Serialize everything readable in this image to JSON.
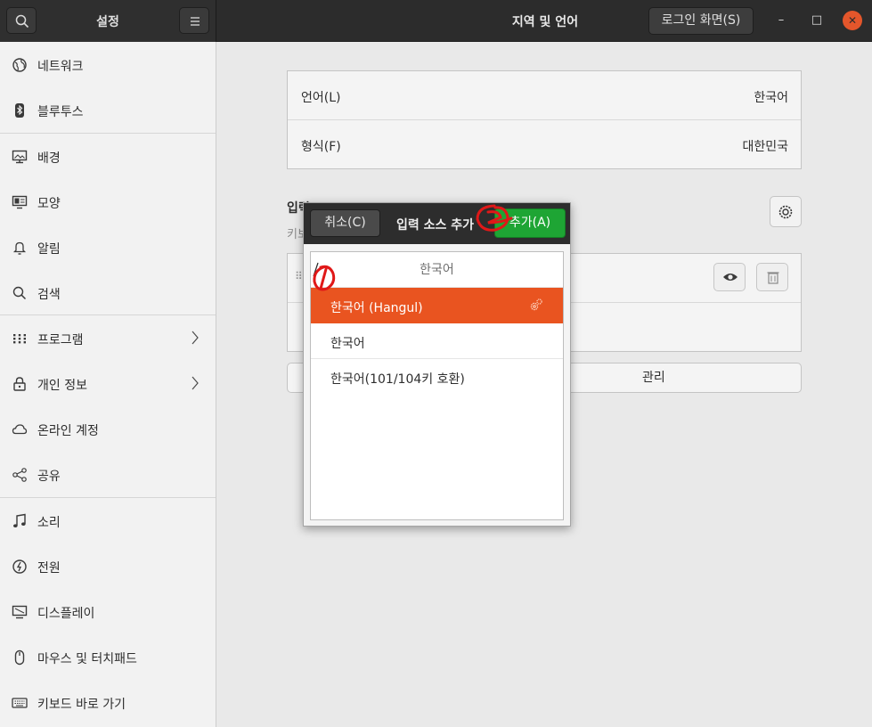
{
  "window": {
    "left_title": "설정",
    "title": "지역 및 언어",
    "login_button": "로그인 화면(S)",
    "min_symbol": "–",
    "max_symbol": "□",
    "close_symbol": "✕"
  },
  "sidebar": {
    "items": [
      {
        "label": "네트워크",
        "icon": "network-icon"
      },
      {
        "label": "블루투스",
        "icon": "bluetooth-icon"
      },
      {
        "label": "배경",
        "icon": "background-icon"
      },
      {
        "label": "모양",
        "icon": "appearance-icon"
      },
      {
        "label": "알림",
        "icon": "bell-icon"
      },
      {
        "label": "검색",
        "icon": "search-icon"
      },
      {
        "label": "프로그램",
        "icon": "apps-grid-icon"
      },
      {
        "label": "개인 정보",
        "icon": "lock-icon"
      },
      {
        "label": "온라인 계정",
        "icon": "cloud-icon"
      },
      {
        "label": "공유",
        "icon": "share-icon"
      },
      {
        "label": "소리",
        "icon": "music-note-icon"
      },
      {
        "label": "전원",
        "icon": "power-icon"
      },
      {
        "label": "디스플레이",
        "icon": "display-icon"
      },
      {
        "label": "마우스 및 터치패드",
        "icon": "mouse-icon"
      },
      {
        "label": "키보드 바로 가기",
        "icon": "keyboard-icon"
      }
    ]
  },
  "main": {
    "language_label": "언어(L)",
    "language_value": "한국어",
    "formats_label": "형식(F)",
    "formats_value": "대한민국",
    "input_section_title": "입력",
    "input_section_sub": "키보",
    "manage_button": "관리"
  },
  "dialog": {
    "cancel": "취소(C)",
    "title": "입력 소스 추가",
    "add": "추가(A)",
    "search_text": "한국어",
    "items": [
      {
        "label": "한국어 (Hangul)",
        "selected": true
      },
      {
        "label": "한국어",
        "selected": false
      },
      {
        "label": "한국어(101/104키 호환)",
        "selected": false
      }
    ]
  },
  "colors": {
    "accent": "#e95420",
    "add_green": "#1ea534",
    "annotation_red": "#e01818"
  }
}
